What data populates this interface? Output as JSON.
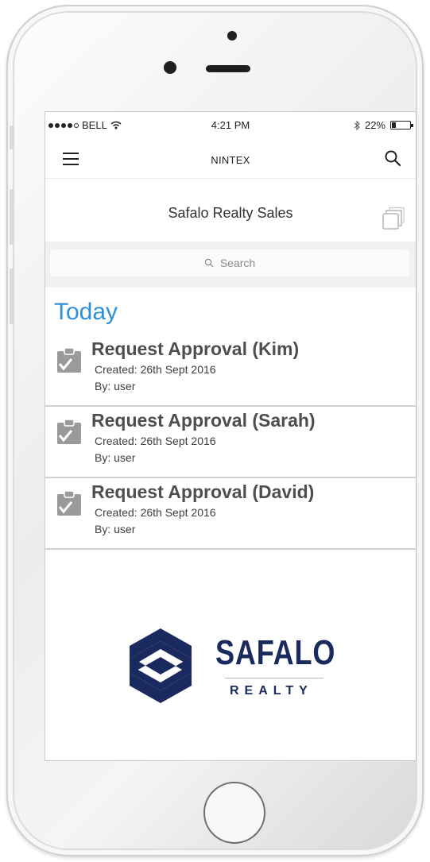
{
  "status_bar": {
    "carrier": "BELL",
    "time": "4:21 PM",
    "battery": "22%",
    "battery_level": 0.22
  },
  "nav": {
    "title": "NINTEX"
  },
  "list": {
    "title": "Safalo Realty Sales"
  },
  "search": {
    "placeholder": "Search"
  },
  "section": {
    "header": "Today"
  },
  "items": [
    {
      "title": "Request Approval (Kim)",
      "created": "Created: 26th Sept 2016",
      "by": "By: user"
    },
    {
      "title": "Request Approval (Sarah)",
      "created": "Created: 26th Sept 2016",
      "by": "By: user"
    },
    {
      "title": "Request Approval (David)",
      "created": "Created: 26th Sept 2016",
      "by": "By: user"
    }
  ],
  "logo": {
    "name": "SAFALO",
    "sub": "REALTY"
  },
  "colors": {
    "accent": "#2f8fd6",
    "brand": "#1b2a5e"
  },
  "icons": {
    "menu": "hamburger-menu-icon",
    "search": "search-icon",
    "views": "stacked-windows-icon",
    "item": "clipboard-check-icon"
  }
}
